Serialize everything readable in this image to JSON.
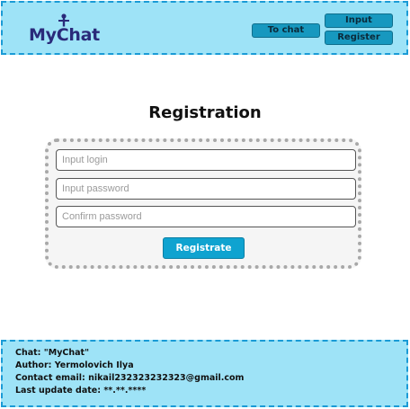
{
  "header": {
    "logo_text": "MyChat",
    "to_chat_label": "To chat",
    "input_label": "Input",
    "register_label": "Register"
  },
  "main": {
    "title": "Registration",
    "login_placeholder": "Input login",
    "password_placeholder": "Input password",
    "confirm_placeholder": "Confirm password",
    "submit_label": "Registrate"
  },
  "footer": {
    "chat_line": "Chat: \"MyChat\"",
    "author_line": "Author: Yermolovich Ilya",
    "email_line": "Contact email: nikail232323232323@gmail.com",
    "update_line": "Last update date: **.**.****"
  },
  "colors": {
    "header_bg": "#9ee3f7",
    "border_accent": "#1a9bd6",
    "button_primary": "#0fa3d0",
    "logo_color": "#2a2a7a"
  },
  "icons": {
    "logo": "person-icon"
  }
}
